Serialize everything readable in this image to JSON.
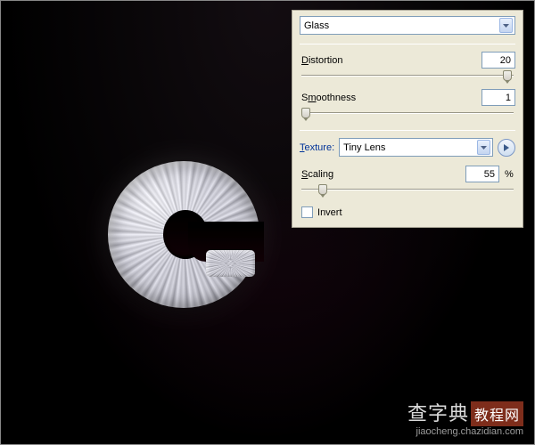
{
  "letter": "G",
  "panel": {
    "filter_select": "Glass",
    "distortion": {
      "label": "Distortion",
      "value": "20",
      "position": 97
    },
    "smoothness": {
      "label": "Smoothness",
      "value": "1",
      "position": 0
    },
    "texture": {
      "label": "Texture:",
      "value": "Tiny Lens"
    },
    "scaling": {
      "label": "Scaling",
      "value": "55",
      "unit": "%",
      "position": 8
    },
    "invert": {
      "label": "Invert",
      "checked": false
    }
  },
  "watermark": {
    "main_a": "查字典",
    "main_b": "教程网",
    "sub": "jiaocheng.chazidian.com"
  }
}
